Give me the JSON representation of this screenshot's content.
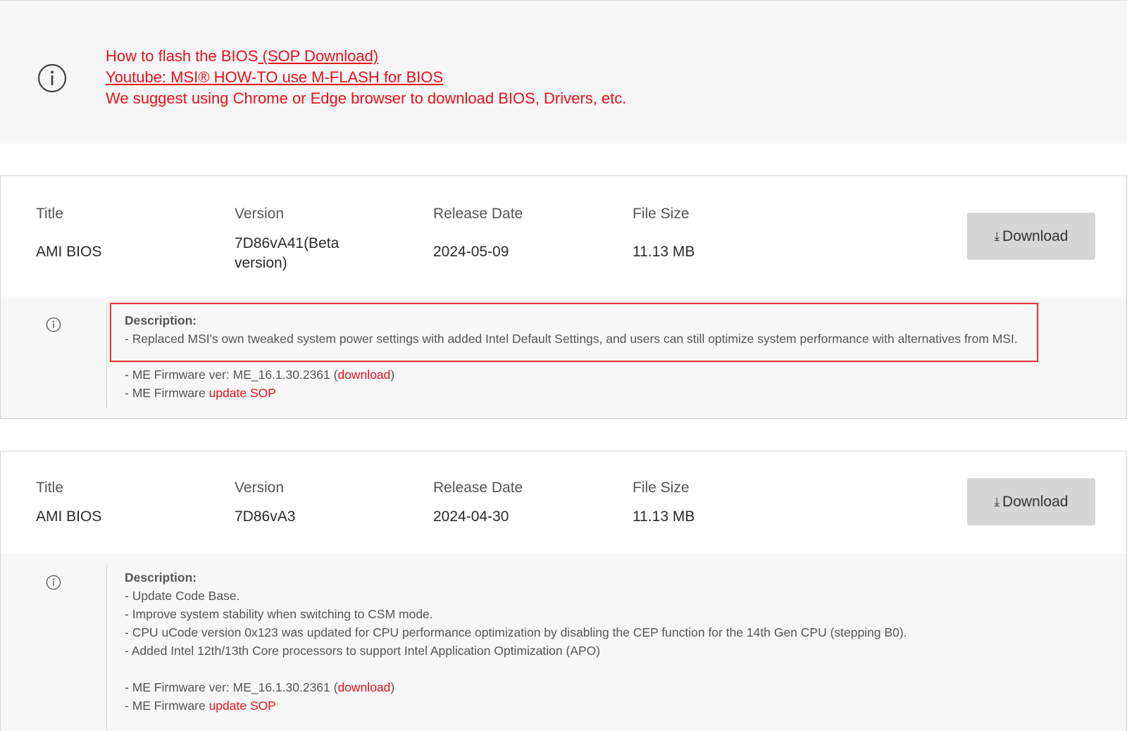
{
  "notice": {
    "line1_text": "How to flash the BIOS",
    "line1_link": " (SOP Download)",
    "line2_link": "Youtube: MSI® HOW-TO use M-FLASH for BIOS",
    "line3_text": "We suggest using Chrome or Edge browser to download BIOS, Drivers, etc."
  },
  "labels": {
    "title": "Title",
    "version": "Version",
    "release_date": "Release Date",
    "file_size": "File Size",
    "download": "Download",
    "description": "Description:"
  },
  "colors": {
    "accent": "#e8111b",
    "highlight_box": "#e03a3e",
    "button_bg": "#d6d6d6"
  },
  "items": [
    {
      "title": "AMI BIOS",
      "version_line1": "7D86vA41(Beta",
      "version_line2": "version)",
      "release_date": "2024-05-09",
      "file_size": "11.13 MB",
      "desc_lines": [
        "- Replaced MSI's own tweaked system power settings with added Intel Default Settings, and users can still optimize system performance with alternatives from MSI."
      ],
      "me_fw_prefix": "- ME Firmware ver: ME_16.1.30.2361 (",
      "me_fw_link": "download",
      "me_fw_suffix": ")",
      "me_sop_prefix": "- ME Firmware ",
      "me_sop_link": "update SOP"
    },
    {
      "title": "AMI BIOS",
      "version": "7D86vA3",
      "release_date": "2024-04-30",
      "file_size": "11.13 MB",
      "desc_lines": [
        "- Update Code Base.",
        "- Improve system stability when switching to CSM mode.",
        "- CPU uCode version 0x123 was updated for CPU performance optimization by disabling the CEP function for the 14th Gen CPU (stepping B0).",
        "- Added Intel 12th/13th Core processors to support Intel Application Optimization (APO)"
      ],
      "me_fw_prefix": "- ME Firmware ver: ME_16.1.30.2361 (",
      "me_fw_link": "download",
      "me_fw_suffix": ")",
      "me_sop_prefix": "- ME Firmware ",
      "me_sop_link": "update SOP"
    }
  ]
}
